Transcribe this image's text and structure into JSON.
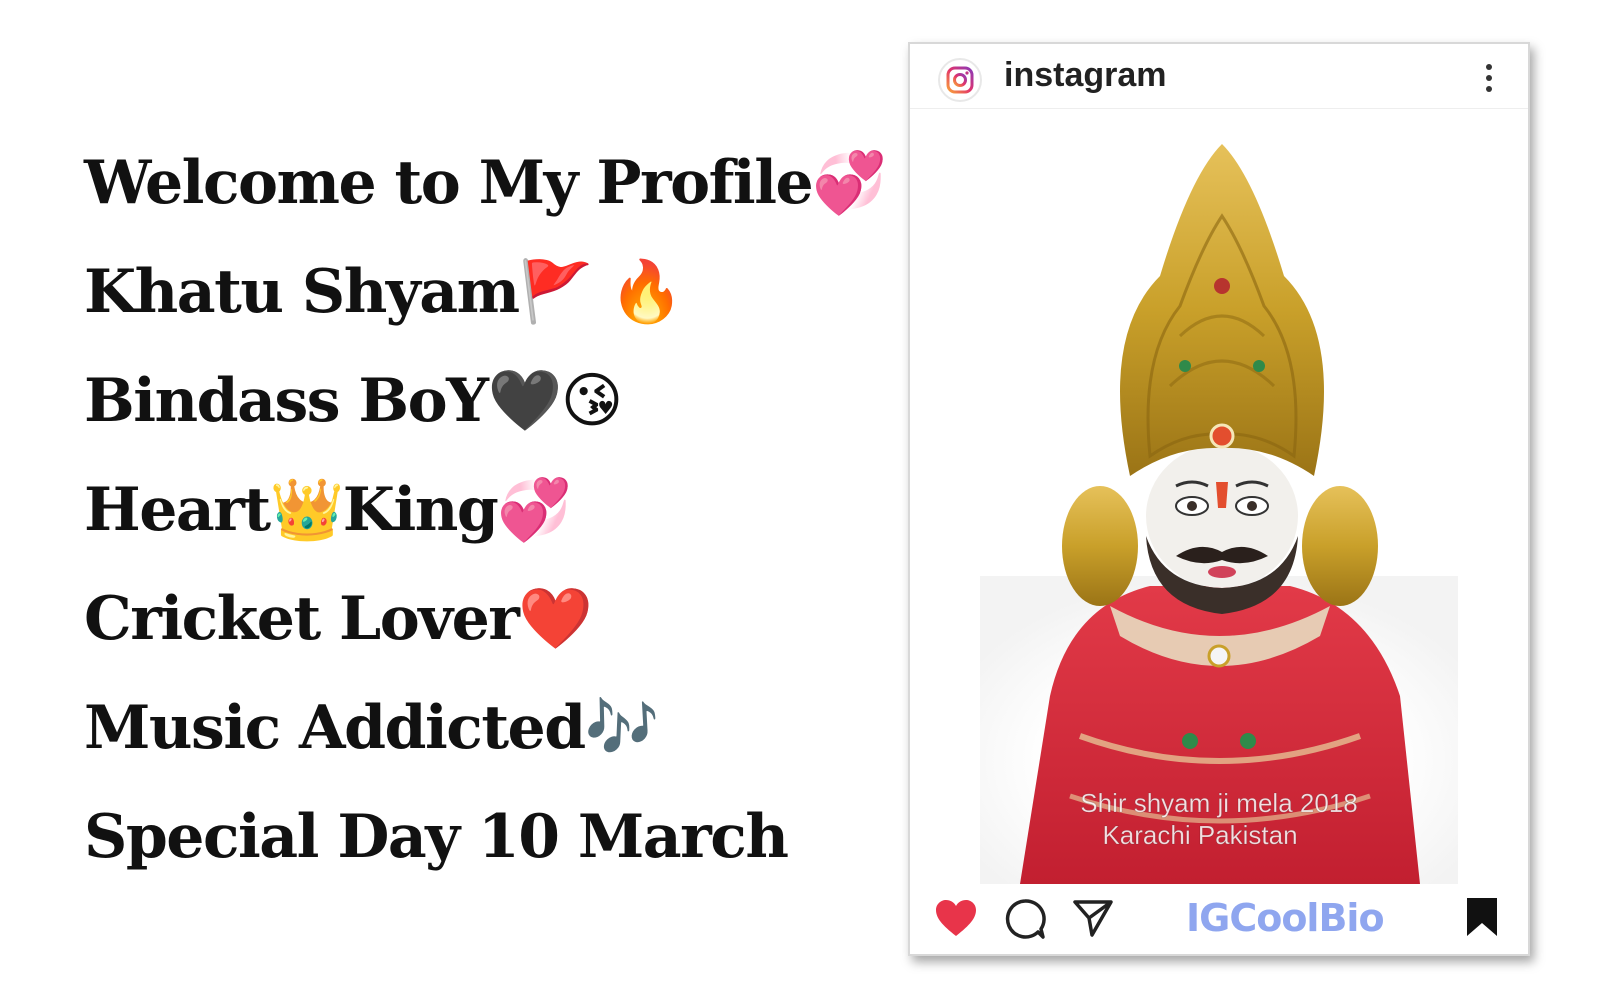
{
  "bio": {
    "lines": [
      {
        "text": "Welcome to My Profile",
        "emoji": "💞"
      },
      {
        "text": "Khatu Shyam ",
        "emoji": "🚩 🔥"
      },
      {
        "text": "Bindass BoY ",
        "emoji": "🖤😘"
      },
      {
        "text": "Heart",
        "emoji": "👑",
        "text2": "King",
        "emoji2": "💞"
      },
      {
        "text": "Cricket Lover ",
        "emoji": "❤️"
      },
      {
        "text": "Music Addicted",
        "emoji": "🎶"
      },
      {
        "text": "Special Day 10 March",
        "emoji": ""
      }
    ]
  },
  "post": {
    "username": "instagram",
    "caption_line1": "Shir shyam ji mela 2018",
    "caption_line2": "Karachi Pakistan",
    "brand": "IGCoolBio",
    "icons": [
      "instagram-logo-icon",
      "more-options-icon",
      "heart-icon",
      "comment-icon",
      "share-icon",
      "bookmark-icon"
    ]
  },
  "colors": {
    "like_heart": "#e8344a",
    "brand": "#8fa6ef",
    "robe": "#d8283a",
    "crown": "#c9a02a"
  }
}
